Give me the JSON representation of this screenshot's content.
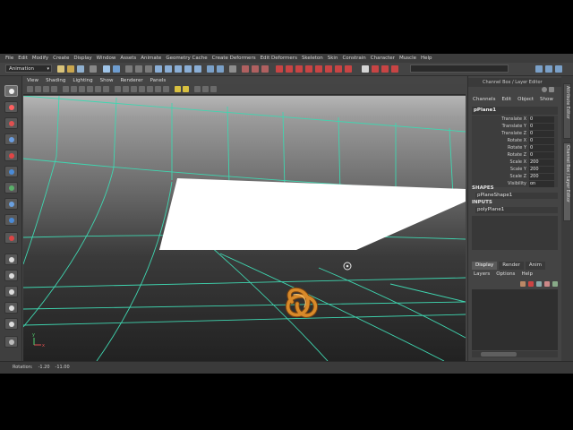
{
  "menubar": {
    "items": [
      "File",
      "Edit",
      "Modify",
      "Create",
      "Display",
      "Window",
      "Assets",
      "Animate",
      "Geometry Cache",
      "Create Deformers",
      "Edit Deformers",
      "Skeleton",
      "Skin",
      "Constrain",
      "Character",
      "Muscle",
      "Help"
    ]
  },
  "statusline": {
    "mode": "Animation"
  },
  "viewport": {
    "menu": [
      "View",
      "Shading",
      "Lighting",
      "Show",
      "Renderer",
      "Panels"
    ],
    "axis_x": "x",
    "axis_y": "y"
  },
  "channel_box": {
    "title": "Channel Box / Layer Editor",
    "tabs": [
      "Channels",
      "Edit",
      "Object",
      "Show"
    ],
    "object": "pPlane1",
    "attributes": [
      {
        "label": "Translate X",
        "value": "0"
      },
      {
        "label": "Translate Y",
        "value": "0"
      },
      {
        "label": "Translate Z",
        "value": "0"
      },
      {
        "label": "Rotate X",
        "value": "0"
      },
      {
        "label": "Rotate Y",
        "value": "0"
      },
      {
        "label": "Rotate Z",
        "value": "0"
      },
      {
        "label": "Scale X",
        "value": "200"
      },
      {
        "label": "Scale Y",
        "value": "200"
      },
      {
        "label": "Scale Z",
        "value": "200"
      },
      {
        "label": "Visibility",
        "value": "on"
      }
    ],
    "shapes_header": "SHAPES",
    "shape": "pPlaneShape1",
    "inputs_header": "INPUTS",
    "input": "polyPlane1"
  },
  "layer_editor": {
    "tabs": [
      "Display",
      "Render",
      "Anim"
    ],
    "menu": [
      "Layers",
      "Options",
      "Help"
    ]
  },
  "side_tabs": [
    "Attribute Editor",
    "Channel Box / Layer Editor"
  ],
  "timeline": {
    "label": "Rotation:",
    "values": [
      "-1.20",
      "-11.00"
    ]
  },
  "colors": {
    "grid": "#3fd6b0",
    "knot": "#d88a2a",
    "plane": "#ffffff",
    "selection_icon": "#cc2222"
  }
}
